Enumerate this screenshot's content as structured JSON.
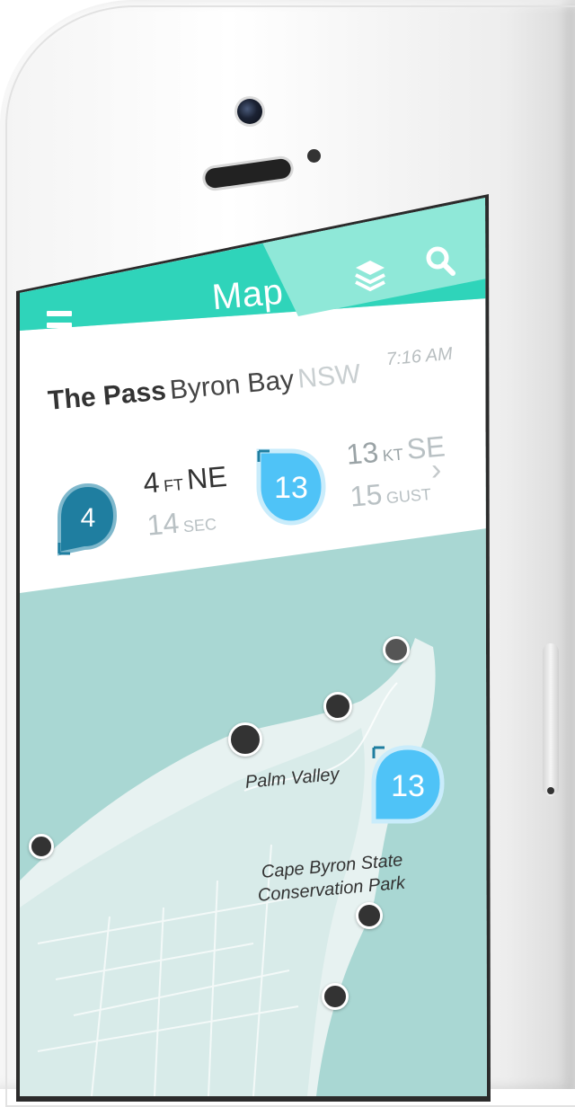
{
  "header": {
    "title": "Map"
  },
  "spot": {
    "name": "The Pass",
    "town": "Byron Bay",
    "state": "NSW",
    "time": "7:16 AM"
  },
  "swell": {
    "rating": "4",
    "height": "4",
    "height_unit": "FT",
    "direction": "NE",
    "period": "14",
    "period_unit": "SEC"
  },
  "wind": {
    "rating": "13",
    "speed": "13",
    "speed_unit": "KT",
    "direction": "SE",
    "gust": "15",
    "gust_unit": "GUST"
  },
  "map": {
    "labels": {
      "palm_valley": "Palm Valley",
      "park_line1": "Cape Byron State",
      "park_line2": "Conservation Park"
    },
    "wind_marker": "13"
  },
  "icons": [
    "menu-icon",
    "layers-icon",
    "search-icon",
    "chevron-right-icon"
  ],
  "colors": {
    "accent": "#2fd4ba",
    "swell_badge": "#1f7ea0",
    "wind_badge": "#4fc3f7",
    "map_water": "#a9d7d3"
  }
}
